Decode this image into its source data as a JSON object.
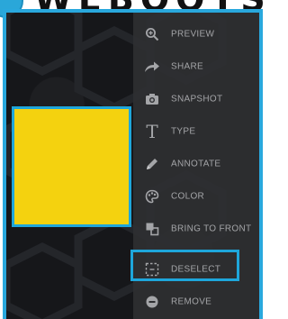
{
  "menu": {
    "items": [
      {
        "id": "preview",
        "label": "PREVIEW",
        "icon": "zoom-in-icon"
      },
      {
        "id": "share",
        "label": "SHARE",
        "icon": "share-arrow-icon"
      },
      {
        "id": "snapshot",
        "label": "SNAPSHOT",
        "icon": "camera-icon"
      },
      {
        "id": "type",
        "label": "TYPE",
        "icon": "text-type-icon"
      },
      {
        "id": "annotate",
        "label": "ANNOTATE",
        "icon": "pencil-icon"
      },
      {
        "id": "color",
        "label": "COLOR",
        "icon": "palette-icon"
      },
      {
        "id": "bring-to-front",
        "label": "BRING TO FRONT",
        "icon": "bring-to-front-icon"
      },
      {
        "id": "deselect",
        "label": "DESELECT",
        "icon": "deselect-icon",
        "highlighted": true
      },
      {
        "id": "remove",
        "label": "REMOVE",
        "icon": "minus-circle-icon"
      }
    ]
  },
  "colors": {
    "accent": "#29a8dd",
    "selected_layer": "#f4d20f",
    "menu_background": "#2e2f32",
    "menu_text": "#a4a5a8"
  }
}
